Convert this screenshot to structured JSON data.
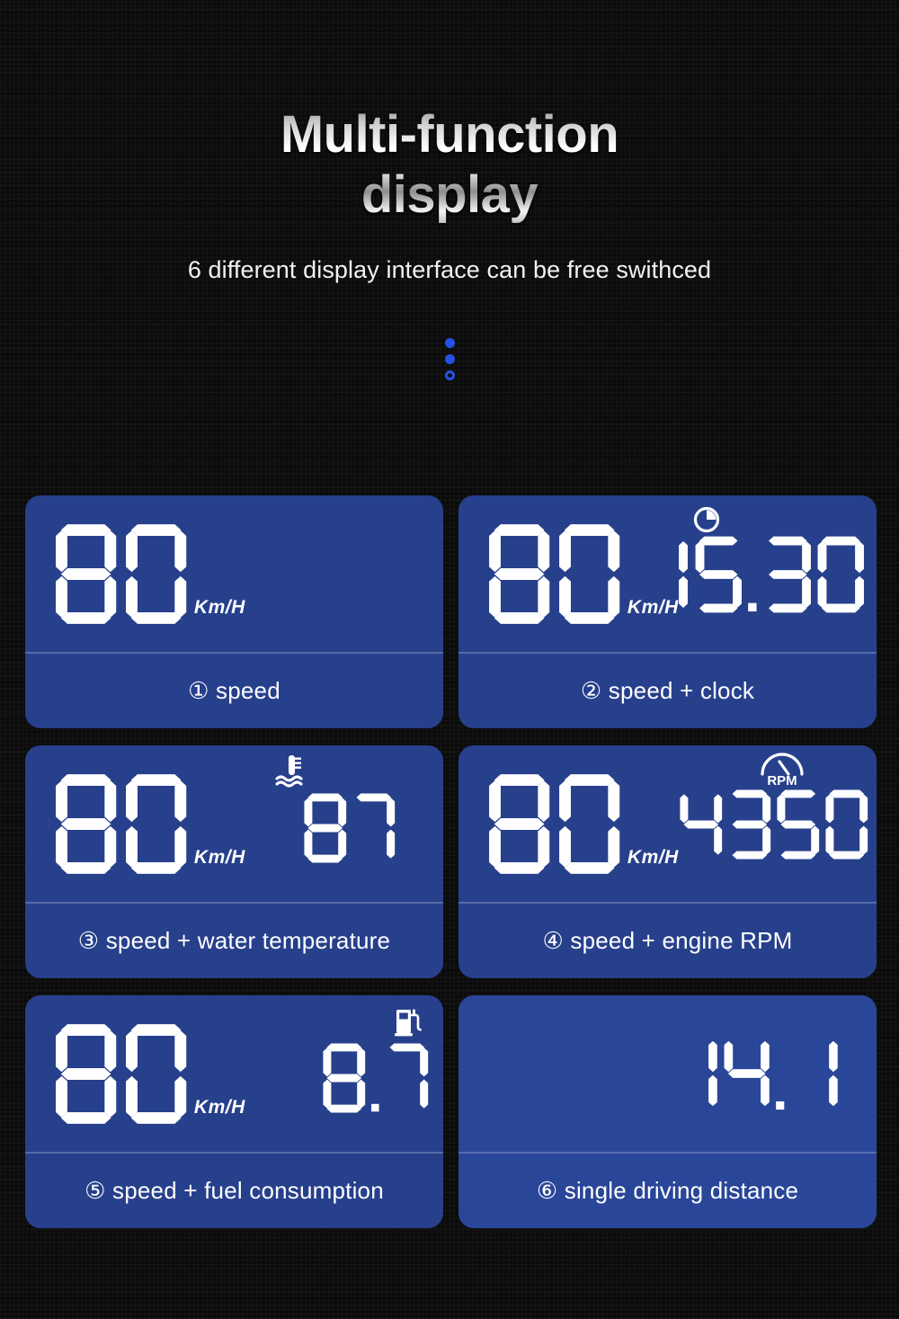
{
  "header": {
    "title_line1": "Multi-function",
    "title_line2": "display",
    "subtitle": "6 different display interface can be free swithced"
  },
  "pager": {
    "dots": [
      "filled",
      "filled",
      "hollow"
    ],
    "accent_color": "#2551e6"
  },
  "theme": {
    "page_background": "#0a0a0a",
    "card_background": "#27408c",
    "card_background_alt": "#2a4699",
    "lcd_color": "#ffffff",
    "divider_color": "rgba(255,255,255,0.22)"
  },
  "cards": [
    {
      "index": "①",
      "caption": "① speed",
      "speed": "80",
      "unit": "Km/H",
      "aux_value": "",
      "aux_icon": "",
      "alt_bg": false
    },
    {
      "index": "②",
      "caption": "② speed + clock",
      "speed": "80",
      "unit": "Km/H",
      "aux_value": "15.30",
      "aux_icon": "clock-icon",
      "alt_bg": false
    },
    {
      "index": "③",
      "caption": "③ speed + water temperature",
      "speed": "80",
      "unit": "Km/H",
      "aux_value": "87",
      "aux_icon": "coolant-temperature-icon",
      "alt_bg": false
    },
    {
      "index": "④",
      "caption": "④ speed + engine RPM",
      "speed": "80",
      "unit": "Km/H",
      "aux_value": "4350",
      "aux_icon": "rpm-gauge-icon",
      "aux_icon_label": "RPM",
      "alt_bg": false
    },
    {
      "index": "⑤",
      "caption": "⑤ speed + fuel consumption",
      "speed": "80",
      "unit": "Km/H",
      "aux_value": "8.7",
      "aux_icon": "fuel-pump-icon",
      "alt_bg": false
    },
    {
      "index": "⑥",
      "caption": "⑥ single driving distance",
      "speed": "",
      "unit": "",
      "aux_value": "14.1",
      "aux_icon": "",
      "alt_bg": true
    }
  ]
}
